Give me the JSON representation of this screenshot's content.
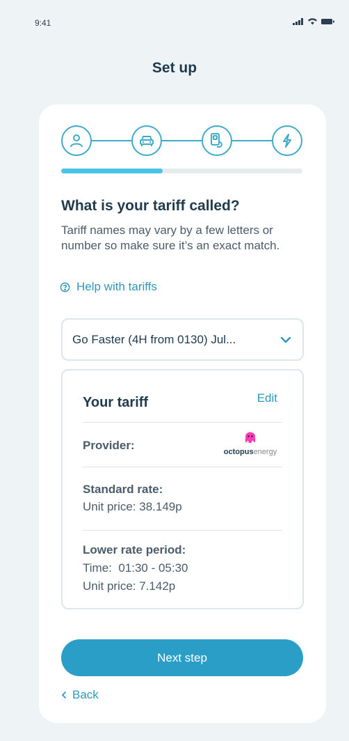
{
  "status_bar": {
    "time": "9:41"
  },
  "header": {
    "title": "Set up"
  },
  "stepper": {
    "steps": [
      {
        "icon": "user-icon"
      },
      {
        "icon": "car-icon"
      },
      {
        "icon": "charger-icon"
      },
      {
        "icon": "lightning-icon"
      }
    ],
    "progress": 0.42
  },
  "question": {
    "title": "What is your tariff called?",
    "description": "Tariff names may vary by a few letters or number so make sure it’s an exact match."
  },
  "help": {
    "label": "Help with tariffs",
    "icon": "question-circle-icon"
  },
  "tariff_select": {
    "value": "Go Faster (4H from 0130) Jul...",
    "icon": "chevron-down-icon"
  },
  "tariff_card": {
    "title": "Your tariff",
    "edit_label": "Edit",
    "provider_label": "Provider:",
    "provider_logo": {
      "brand_bold": "octopus",
      "brand_light": "energy",
      "color": "#ff3bb4"
    },
    "standard_rate_label": "Standard rate:",
    "standard_unit_price": "Unit price: 38.149p",
    "lower_rate_label": "Lower rate period:",
    "lower_time": "Time:  01:30 - 05:30",
    "lower_unit_price": "Unit price: 7.142p"
  },
  "actions": {
    "next_label": "Next step",
    "back_label": "Back"
  },
  "colors": {
    "accent": "#2a9ec7",
    "progress": "#49c3e6",
    "background": "#eef3f6"
  }
}
